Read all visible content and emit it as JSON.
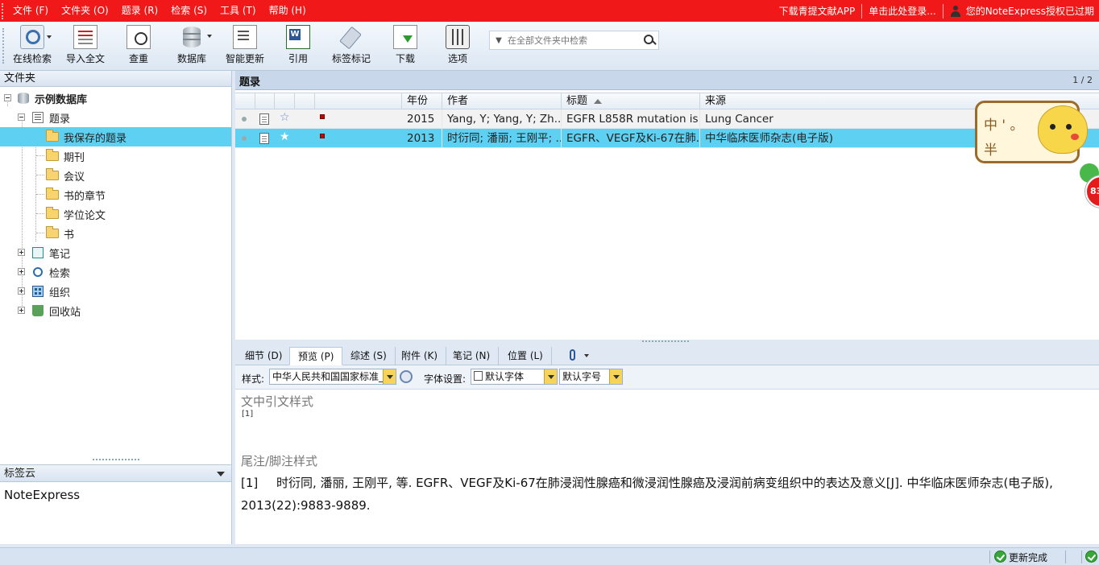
{
  "menubar": {
    "items": [
      "文件 (F)",
      "文件夹 (O)",
      "题录 (R)",
      "检索 (S)",
      "工具 (T)",
      "帮助 (H)"
    ],
    "right": [
      "下载青提文献APP",
      "单击此处登录...",
      "您的NoteExpress授权已过期"
    ]
  },
  "toolbar": {
    "buttons": [
      "在线检索",
      "导入全文",
      "查重",
      "数据库",
      "智能更新",
      "引用",
      "标签标记",
      "下载",
      "选项"
    ],
    "search_placeholder": "在全部文件夹中检索"
  },
  "leftpane": {
    "title": "文件夹",
    "tree": {
      "root": "示例数据库",
      "refs": "题录",
      "folders": [
        "我保存的题录",
        "期刊",
        "会议",
        "书的章节",
        "学位论文",
        "书"
      ],
      "others": [
        "笔记",
        "检索",
        "组织",
        "回收站"
      ]
    },
    "tagcloud_title": "标签云",
    "tagcloud_items": [
      "NoteExpress"
    ]
  },
  "refs": {
    "title": "题录",
    "pager": "1 / 2",
    "columns": [
      "年份",
      "作者",
      "标题",
      "来源"
    ],
    "rows": [
      {
        "year": "2015",
        "author": "Yang, Y; Yang, Y; Zh...",
        "title": "EGFR L858R mutation is...",
        "source": "Lung Cancer"
      },
      {
        "year": "2013",
        "author": "时衍同; 潘丽; 王刚平; ...",
        "title": "EGFR、VEGF及Ki-67在肺...",
        "source": "中华临床医师杂志(电子版)"
      }
    ]
  },
  "mascot": {
    "line1": "中 ' 。",
    "line2": "半",
    "badge": "83"
  },
  "tabs": [
    "细节 (D)",
    "预览 (P)",
    "综述 (S)",
    "附件 (K)",
    "笔记 (N)",
    "位置 (L)"
  ],
  "preview": {
    "style_label": "样式:",
    "style_value": "中华人民共和国国家标准_",
    "font_label": "字体设置:",
    "font_value": "默认字体",
    "size_value": "默认字号",
    "intext_title": "文中引文样式",
    "intext_mark": "[1]",
    "footnote_title": "尾注/脚注样式",
    "ref_num": "[1]",
    "ref_text": "时衍同, 潘丽, 王刚平, 等. EGFR、VEGF及Ki-67在肺浸润性腺癌和微浸润性腺癌及浸润前病变组织中的表达及意义[J]. 中华临床医师杂志(电子版), 2013(22):9883-9889."
  },
  "status": {
    "text": "更新完成"
  }
}
